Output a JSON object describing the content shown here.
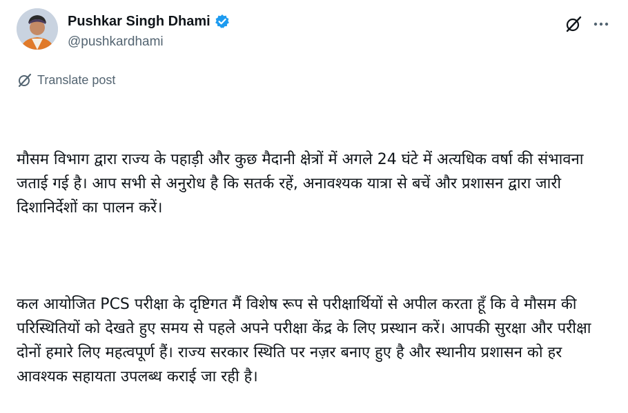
{
  "author": {
    "display_name": "Pushkar Singh Dhami",
    "handle": "@pushkardhami",
    "verified_icon": "verified-badge-icon",
    "verified_color": "#1d9bf0"
  },
  "actions": {
    "grok_icon": "grok-icon",
    "more_icon": "more-options-icon"
  },
  "translate": {
    "label": "Translate post",
    "icon": "translate-icon"
  },
  "post": {
    "paragraphs": [
      "मौसम विभाग द्वारा राज्य के पहाड़ी और कुछ मैदानी क्षेत्रों में अगले 24 घंटे में अत्यधिक वर्षा की संभावना जताई गई है। आप सभी से अनुरोध है कि सतर्क रहें, अनावश्यक यात्रा से बचें और प्रशासन द्वारा जारी दिशानिर्देशों का पालन करें।",
      "कल आयोजित PCS परीक्षा के दृष्टिगत मैं विशेष रूप से परीक्षार्थियों से अपील करता हूँ कि वे मौसम की परिस्थितियों को देखते हुए समय से पहले अपने परीक्षा केंद्र के लिए प्रस्थान करें। आपकी सुरक्षा और परीक्षा दोनों हमारे लिए महत्वपूर्ण हैं। राज्य सरकार स्थिति पर नज़र बनाए हुए है और स्थानीय प्रशासन को हर आवश्यक सहायता उपलब्ध कराई जा रही है।"
    ]
  }
}
